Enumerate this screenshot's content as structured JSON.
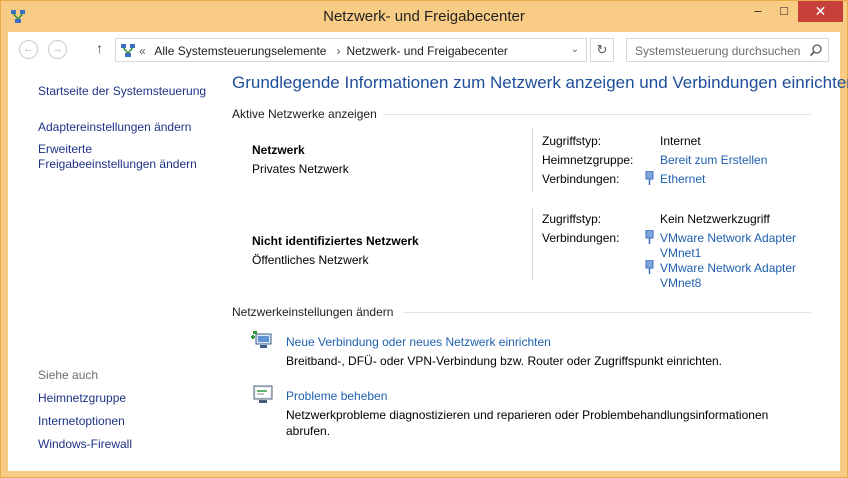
{
  "window": {
    "title": "Netzwerk- und Freigabecenter",
    "min_icon": "minimize-icon",
    "max_icon": "maximize-icon",
    "close_icon": "close-icon",
    "min_glyph": "–",
    "max_glyph": "□",
    "close_glyph": "✕"
  },
  "address_bar": {
    "back_glyph": "←",
    "forward_glyph": "→",
    "up_glyph": "↑",
    "overflow": "«",
    "crumbs": [
      "Alle Systemsteuerungselemente",
      "Netzwerk- und Freigabecenter"
    ],
    "separator": "›",
    "dropdown_glyph": "⌄",
    "refresh_glyph": "↻",
    "search_placeholder": "Systemsteuerung durchsuchen"
  },
  "sidebar": {
    "home": "Startseite der Systemsteuerung",
    "adapter": "Adaptereinstellungen ändern",
    "sharing_line1": "Erweiterte",
    "sharing_line2": "Freigabeeinstellungen ändern",
    "see_also": "Siehe auch",
    "links": [
      "Heimnetzgruppe",
      "Internetoptionen",
      "Windows-Firewall"
    ]
  },
  "main": {
    "heading": "Grundlegende Informationen zum Netzwerk anzeigen und Verbindungen einrichten",
    "active_label": "Aktive Netzwerke anzeigen",
    "networks": [
      {
        "name": "Netzwerk",
        "type": "Privates Netzwerk",
        "access_label": "Zugriffstyp:",
        "access_value": "Internet",
        "homegroup_label": "Heimnetzgruppe:",
        "homegroup_value": "Bereit zum Erstellen",
        "connections_label": "Verbindungen:",
        "connections": [
          "Ethernet"
        ]
      },
      {
        "name": "Nicht identifiziertes Netzwerk",
        "type": "Öffentliches Netzwerk",
        "access_label": "Zugriffstyp:",
        "access_value": "Kein Netzwerkzugriff",
        "connections_label": "Verbindungen:",
        "connections": [
          {
            "line1": "VMware Network Adapter",
            "line2": "VMnet1"
          },
          {
            "line1": "VMware Network Adapter",
            "line2": "VMnet8"
          }
        ]
      }
    ],
    "change_label": "Netzwerkeinstellungen ändern",
    "tasks": [
      {
        "title": "Neue Verbindung oder neues Netzwerk einrichten",
        "desc": "Breitband-, DFÜ- oder VPN-Verbindung bzw. Router oder Zugriffspunkt einrichten.",
        "icon": "new-connection-icon"
      },
      {
        "title": "Probleme beheben",
        "desc": "Netzwerkprobleme diagnostizieren und reparieren oder Problembehandlungsinformationen abrufen.",
        "icon": "troubleshoot-icon"
      }
    ]
  },
  "colors": {
    "frame": "#f9cc85",
    "close": "#c7413a",
    "link": "#1e5fb0",
    "heading": "#1e4e9a"
  }
}
